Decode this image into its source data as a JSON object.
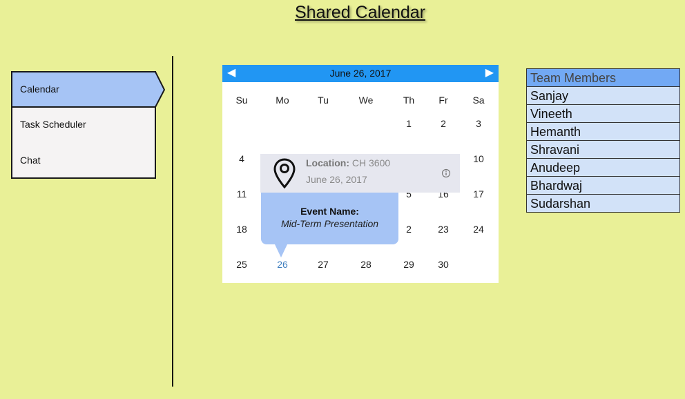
{
  "app": {
    "title": "Shared Calendar"
  },
  "nav": {
    "items": [
      "Calendar",
      "Task Scheduler",
      "Chat"
    ],
    "active": "Calendar"
  },
  "calendar": {
    "header": "June 26, 2017",
    "prev_icon": "left-triangle-arrow",
    "next_icon": "right-triangle-arrow",
    "weekdays": [
      "Su",
      "Mo",
      "Tu",
      "We",
      "Th",
      "Fr",
      "Sa"
    ],
    "weeks": [
      [
        "",
        "",
        "",
        "",
        "1",
        "2",
        "3"
      ],
      [
        "4",
        "",
        "",
        "",
        "",
        "",
        "10"
      ],
      [
        "11",
        "",
        "",
        "",
        "5",
        "16",
        "17"
      ],
      [
        "18",
        "",
        "",
        "",
        "2",
        "23",
        "24"
      ],
      [
        "25",
        "26",
        "27",
        "28",
        "29",
        "30",
        ""
      ]
    ],
    "selected_day": "26"
  },
  "location_popup": {
    "location_label": "Location:",
    "location_value": "CH 3600",
    "date": "June 26, 2017",
    "icon": "map-pin-icon",
    "info_icon": "info-icon"
  },
  "event_popup": {
    "label": "Event Name:",
    "value": "Mid-Term Presentation"
  },
  "team": {
    "header": "Team Members",
    "members": [
      "Sanjay",
      "Vineeth",
      "Hemanth",
      "Shravani",
      "Anudeep",
      "Bhardwaj",
      "Sudarshan"
    ]
  },
  "colors": {
    "background": "#e9f097",
    "accent": "#2196f3",
    "nav_active": "#a6c4f5",
    "team_header": "#72a9f4",
    "team_row": "#d2e2f8"
  }
}
